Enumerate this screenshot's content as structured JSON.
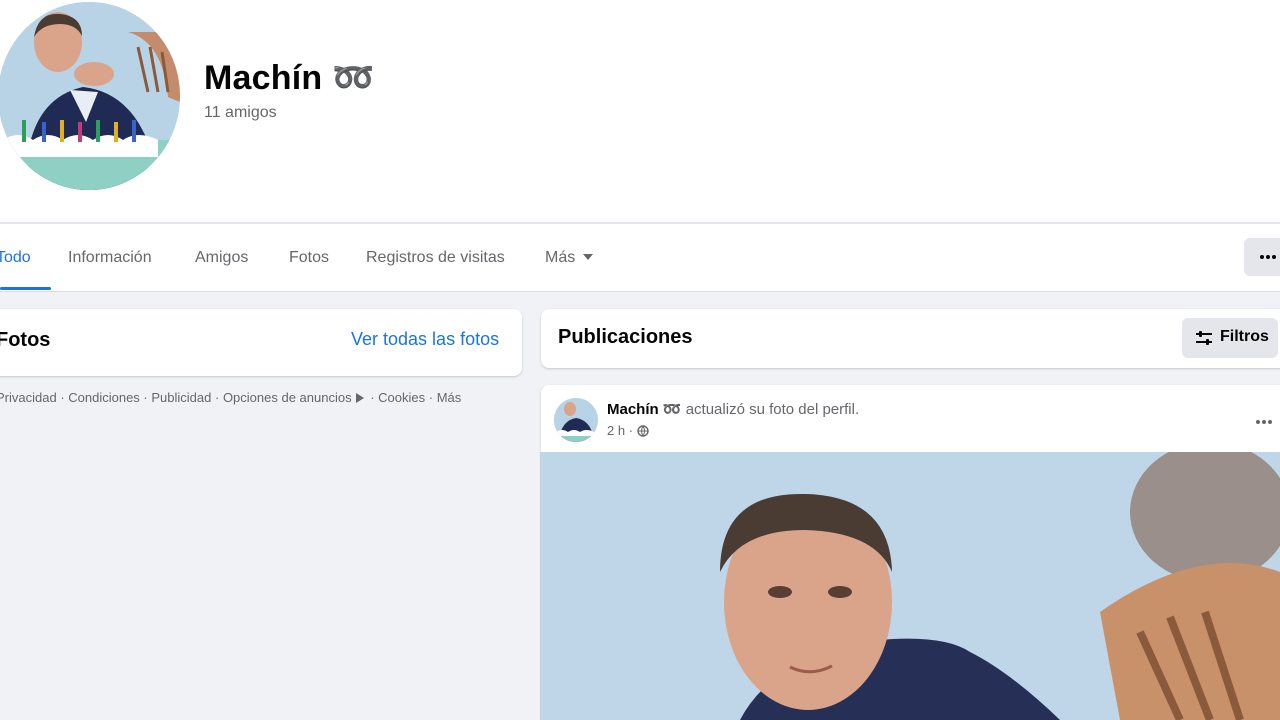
{
  "profile": {
    "name": "Machín ➿",
    "friends": "11 amigos"
  },
  "tabs": {
    "items": [
      {
        "label": "Todo"
      },
      {
        "label": "Información"
      },
      {
        "label": "Amigos"
      },
      {
        "label": "Fotos"
      },
      {
        "label": "Registros de visitas"
      },
      {
        "label": "Más"
      }
    ],
    "active": "Todo",
    "more_icon": "ellipsis-icon"
  },
  "photos": {
    "title": "Fotos",
    "see_all": "Ver todas las fotos"
  },
  "footer": {
    "links": [
      "Privacidad",
      "Condiciones",
      "Publicidad",
      "Opciones de anuncios",
      "Cookies",
      "Más"
    ]
  },
  "publications": {
    "title": "Publicaciones",
    "filters_label": "Filtros",
    "filters_icon": "sliders-icon"
  },
  "post": {
    "author": "Machín ➿",
    "action": "actualizó su foto del perfil.",
    "time": "2 h",
    "privacy_icon": "globe-icon",
    "more_icon": "ellipsis-icon"
  },
  "colors": {
    "accent": "#1b74e4",
    "background": "#f0f2f5",
    "secondary_text": "#65676b",
    "button_gray": "#e4e6eb"
  }
}
